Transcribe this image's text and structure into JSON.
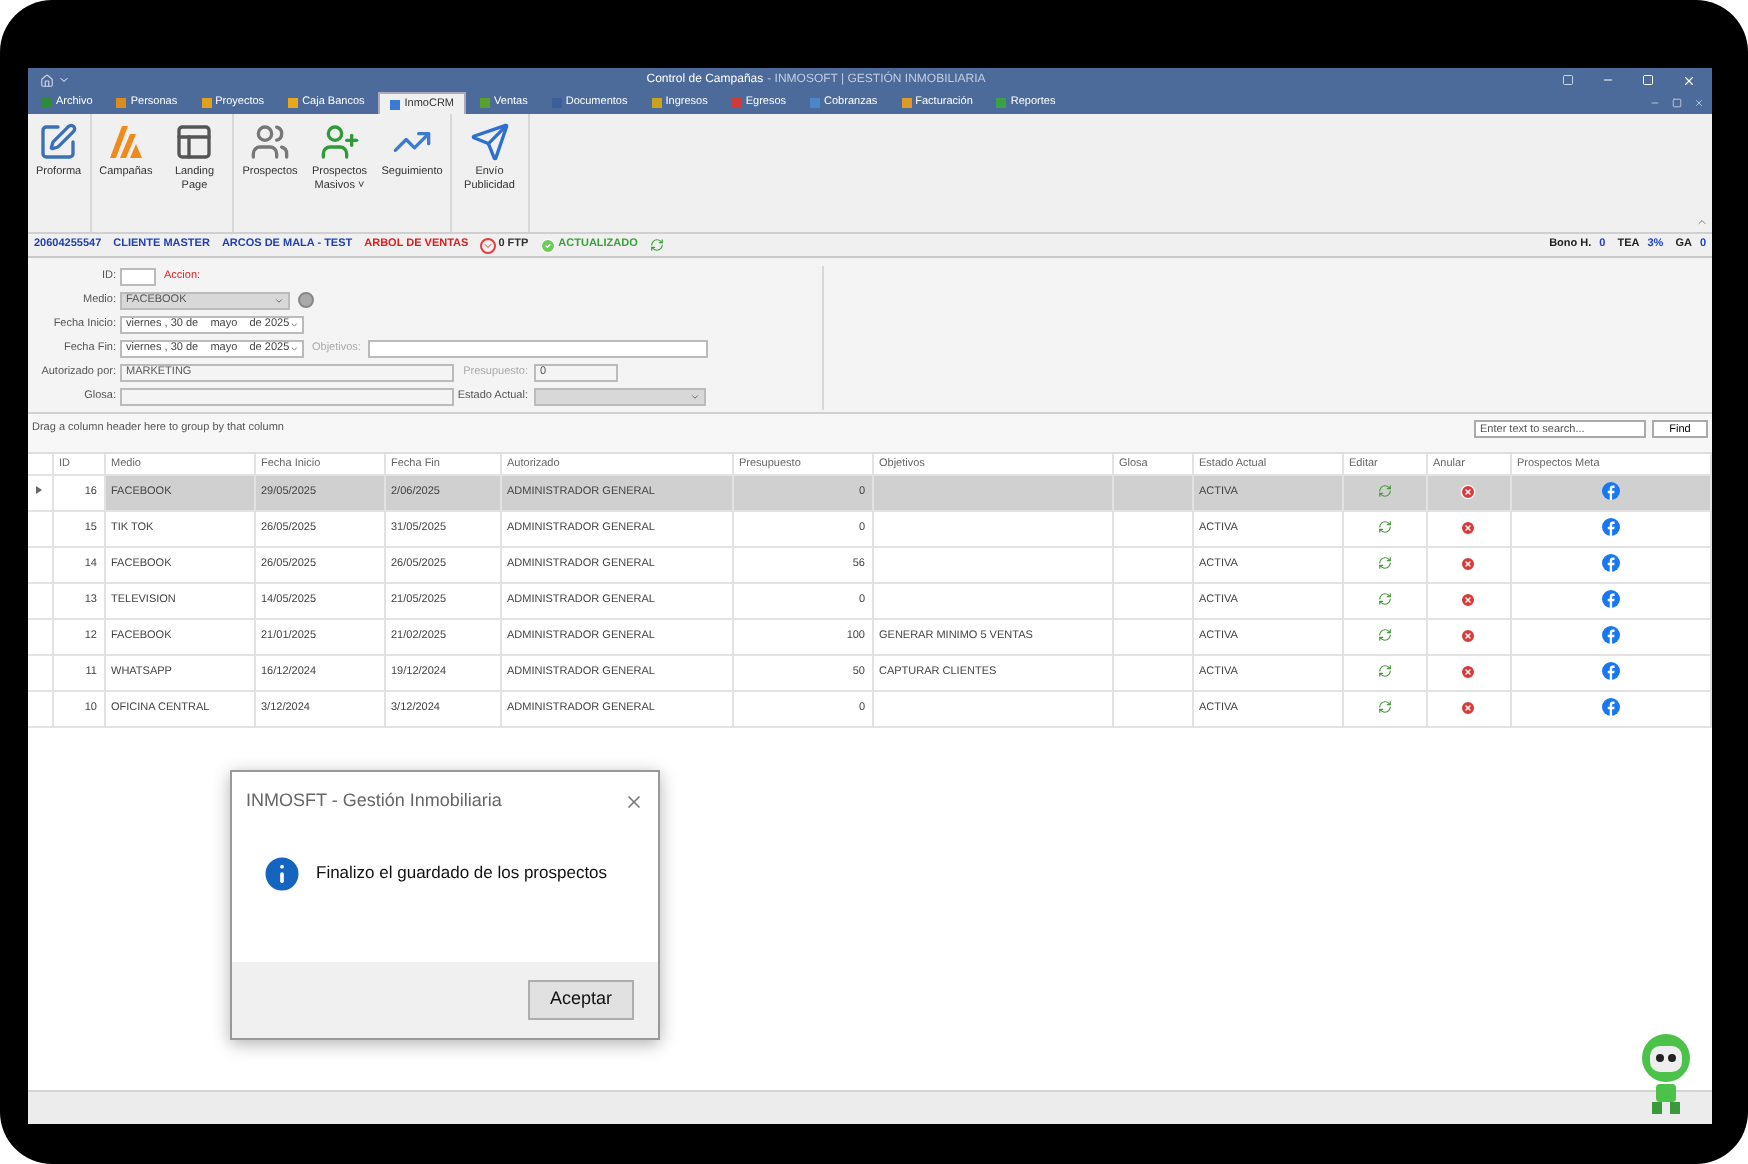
{
  "window": {
    "title": "Control de Campañas",
    "subtitle": "- INMOSOFT | GESTIÓN INMOBILIARIA"
  },
  "menu_tabs": [
    {
      "label": "Archivo",
      "selected": false,
      "color": "#2e8b3a"
    },
    {
      "label": "Personas",
      "selected": false,
      "color": "#d98c1f"
    },
    {
      "label": "Proyectos",
      "selected": false,
      "color": "#e0a020"
    },
    {
      "label": "Caja Bancos",
      "selected": false,
      "color": "#e8a81c"
    },
    {
      "label": "InmoCRM",
      "selected": true,
      "color": "#3a7bd5"
    },
    {
      "label": "Ventas",
      "selected": false,
      "color": "#5aa02c"
    },
    {
      "label": "Documentos",
      "selected": false,
      "color": "#3d5f99"
    },
    {
      "label": "Ingresos",
      "selected": false,
      "color": "#c9a21e"
    },
    {
      "label": "Egresos",
      "selected": false,
      "color": "#d03a3a"
    },
    {
      "label": "Cobranzas",
      "selected": false,
      "color": "#4a86c8"
    },
    {
      "label": "Facturación",
      "selected": false,
      "color": "#e09a2a"
    },
    {
      "label": "Reportes",
      "selected": false,
      "color": "#3aa04a"
    }
  ],
  "ribbon_groups": [
    {
      "buttons": [
        {
          "label": "Proforma",
          "kind": "proforma"
        }
      ]
    },
    {
      "buttons": [
        {
          "label": "Campañas",
          "kind": "campaigns"
        },
        {
          "label": "Landing Page",
          "kind": "landing"
        }
      ]
    },
    {
      "buttons": [
        {
          "label": "Prospectos",
          "kind": "people"
        },
        {
          "label": "Prospectos Masivos ˅",
          "kind": "add-person"
        },
        {
          "label": "Seguimiento",
          "kind": "chart"
        }
      ]
    },
    {
      "buttons": [
        {
          "label": "Envío Publicidad",
          "kind": "send"
        }
      ]
    }
  ],
  "info_bar": {
    "items": [
      {
        "text": "20604255547",
        "color": "#1f3fb0"
      },
      {
        "text": "CLIENTE MASTER",
        "color": "#1f3fb0"
      },
      {
        "text": "ARCOS DE MALA - TEST",
        "color": "#1f3fb0"
      },
      {
        "text": "ARBOL DE VENTAS",
        "color": "#d62020"
      }
    ],
    "ftp": "0 FTP",
    "status": "ACTUALIZADO",
    "right": [
      {
        "label": "Bono H.",
        "value": "0"
      },
      {
        "label": "TEA",
        "value": "3%"
      },
      {
        "label": "GA",
        "value": "0"
      }
    ]
  },
  "form": {
    "id_label": "ID:",
    "action_label": "Accion:",
    "medio_label": "Medio:",
    "medio_value": "FACEBOOK",
    "fecha_inicio_label": "Fecha Inicio:",
    "fecha_inicio_value": "viernes , 30 de    mayo    de 2025",
    "fecha_fin_label": "Fecha Fin:",
    "fecha_fin_value": "viernes , 30 de    mayo    de 2025",
    "objetivos_label": "Objetivos:",
    "autorizado_label": "Autorizado por:",
    "autorizado_value": "MARKETING",
    "presupuesto_label": "Presupuesto:",
    "presupuesto_value": "0",
    "glosa_label": "Glosa:",
    "estado_label": "Estado Actual:"
  },
  "grid": {
    "group_hint": "Drag a column header here to group by that column",
    "search_placeholder": "Enter text to search...",
    "find_button": "Find",
    "columns": [
      "ID",
      "Medio",
      "Fecha Inicio",
      "Fecha Fin",
      "Autorizado",
      "Presupuesto",
      "Objetivos",
      "Glosa",
      "Estado Actual",
      "Editar",
      "Anular",
      "Prospectos Meta"
    ],
    "rows": [
      {
        "id": "16",
        "medio": "FACEBOOK",
        "fecha_inicio": "29/05/2025",
        "fecha_fin": "2/06/2025",
        "autorizado": "ADMINISTRADOR GENERAL",
        "presupuesto": "0",
        "estado": "ACTIVA",
        "selected": true
      },
      {
        "id": "15",
        "medio": "TIK TOK",
        "fecha_inicio": "26/05/2025",
        "fecha_fin": "31/05/2025",
        "autorizado": "ADMINISTRADOR GENERAL",
        "presupuesto": "0",
        "estado": "ACTIVA",
        "selected": false
      },
      {
        "id": "14",
        "medio": "FACEBOOK",
        "fecha_inicio": "26/05/2025",
        "fecha_fin": "26/05/2025",
        "autorizado": "ADMINISTRADOR GENERAL",
        "presupuesto": "56",
        "estado": "ACTIVA",
        "selected": false
      },
      {
        "id": "13",
        "medio": "TELEVISION",
        "fecha_inicio": "14/05/2025",
        "fecha_fin": "21/05/2025",
        "autorizado": "ADMINISTRADOR GENERAL",
        "presupuesto": "0",
        "estado": "ACTIVA",
        "selected": false
      },
      {
        "id": "12",
        "medio": "FACEBOOK",
        "fecha_inicio": "21/01/2025",
        "fecha_fin": "21/02/2025",
        "autorizado": "ADMINISTRADOR GENERAL",
        "presupuesto": "100",
        "objetivos": "GENERAR MINIMO 5 VENTAS",
        "estado": "ACTIVA",
        "selected": false
      },
      {
        "id": "11",
        "medio": "WHATSAPP",
        "fecha_inicio": "16/12/2024",
        "fecha_fin": "19/12/2024",
        "autorizado": "ADMINISTRADOR GENERAL",
        "presupuesto": "50",
        "objetivos": "CAPTURAR CLIENTES",
        "estado": "ACTIVA",
        "selected": false
      },
      {
        "id": "10",
        "medio": "OFICINA CENTRAL",
        "fecha_inicio": "3/12/2024",
        "fecha_fin": "3/12/2024",
        "autorizado": "ADMINISTRADOR GENERAL",
        "presupuesto": "0",
        "estado": "ACTIVA",
        "selected": false
      }
    ]
  },
  "dialog": {
    "title": "INMOSFT - Gestión Inmobiliaria",
    "message": "Finalizo el guardado de los prospectos",
    "button": "Aceptar"
  }
}
